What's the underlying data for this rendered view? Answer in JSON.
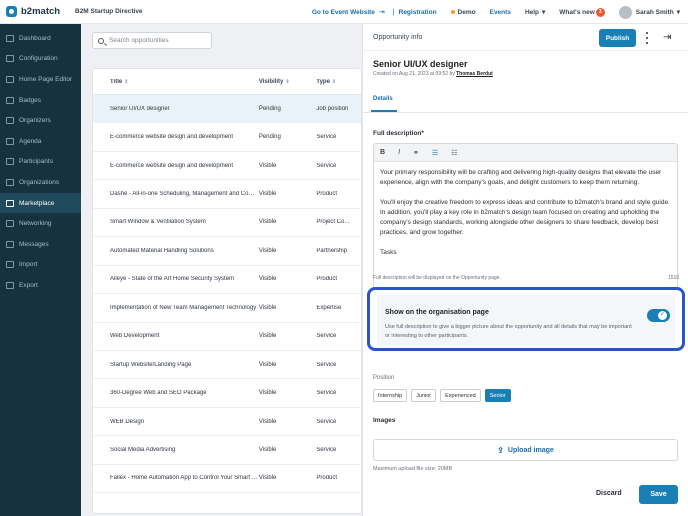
{
  "topbar": {
    "brand": "b2match",
    "event_name": "B2M Startup Directive",
    "goto_event": "Go to Event Website",
    "registration": "Registration",
    "demo": "Demo",
    "events": "Events",
    "help": "Help",
    "whats_new": "What's new",
    "whats_new_count": "3",
    "user_name": "Sarah Smith"
  },
  "sidebar": {
    "items": [
      {
        "label": "Dashboard",
        "icon": "dashboard-icon"
      },
      {
        "label": "Configuration",
        "icon": "gear-icon"
      },
      {
        "label": "Home Page Editor",
        "icon": "page-icon"
      },
      {
        "label": "Badges",
        "icon": "badge-icon"
      },
      {
        "label": "Organizers",
        "icon": "people-icon"
      },
      {
        "label": "Agenda",
        "icon": "calendar-icon"
      },
      {
        "label": "Participants",
        "icon": "users-icon"
      },
      {
        "label": "Organizations",
        "icon": "building-icon"
      },
      {
        "label": "Marketplace",
        "icon": "store-icon",
        "active": true
      },
      {
        "label": "Networking",
        "icon": "network-icon"
      },
      {
        "label": "Messages",
        "icon": "message-icon"
      },
      {
        "label": "Import",
        "icon": "import-icon"
      },
      {
        "label": "Export",
        "icon": "export-icon"
      }
    ]
  },
  "search": {
    "placeholder": "Search opportunities"
  },
  "table": {
    "columns": [
      "Title",
      "Visibility",
      "Type"
    ],
    "rows": [
      [
        "Senior UI/UX designer",
        "Pending",
        "Job position"
      ],
      [
        "E-commerce website design and development",
        "Pending",
        "Service"
      ],
      [
        "E-commerce website design and development",
        "Visible",
        "Service"
      ],
      [
        "Dashe - All-in-one Scheduling, Management and Commu...",
        "Visible",
        "Product"
      ],
      [
        "Smart Window & Ventilation System",
        "Visible",
        "Project Co..."
      ],
      [
        "Automated Material Handling Solutions",
        "Visible",
        "Partnership"
      ],
      [
        "Alleye - State of the Art Home Security System",
        "Visible",
        "Product"
      ],
      [
        "Implementation of New Team Management Technology",
        "Visible",
        "Expertise"
      ],
      [
        "Web Development",
        "Visible",
        "Service"
      ],
      [
        "Startup Website/Landing Page",
        "Visible",
        "Service"
      ],
      [
        "360-Degree Web and SEO Package",
        "Visible",
        "Service"
      ],
      [
        "WEB Design",
        "Visible",
        "Service"
      ],
      [
        "Social Media Advertising",
        "Visible",
        "Service"
      ],
      [
        "Fallex - Home Automation App to Control Your Smart De...",
        "Visible",
        "Product"
      ]
    ]
  },
  "panel": {
    "header": "Opportunity info",
    "publish": "Publish",
    "title": "Senior UI/UX designer",
    "created_prefix": "Created on Aug 21, 2023 at 09:52 by",
    "created_by": "Thomas Berdut",
    "tab": "Details",
    "full_desc_label": "Full description*",
    "description": [
      "Your primary responsibility will be crafting and delivering high-quality designs that elevate the user experience, align with the company's goals, and delight customers to keep them returning.",
      "You'll enjoy the creative freedom to express ideas and contribute to b2match's brand and style guide. In addition, you'll play a key role in b2match's design team focused on creating and upholding the company's design standards, working alongside other designers to share feedback, develop best practices, and grow together.",
      "Tasks"
    ],
    "desc_hint": "Full description will be displayed on the Opportunity page.",
    "char_count": "1510",
    "show_org_title": "Show on the organisation page",
    "show_org_desc": "Use full description to give a bigger picture about the opportunity and all details that may be important or interesting to other participants.",
    "position_label": "Position",
    "positions": [
      "Internship",
      "Junior",
      "Experienced",
      "Senior"
    ],
    "position_selected": "Senior",
    "images_label": "Images",
    "upload_label": "Upload image",
    "max_size": "Maximum upload file size: 20MB",
    "discard": "Discard",
    "save": "Save"
  },
  "colors": {
    "accent": "#1a7fb5",
    "sidebar_bg": "#163240",
    "highlight_border": "#2a54c8"
  }
}
